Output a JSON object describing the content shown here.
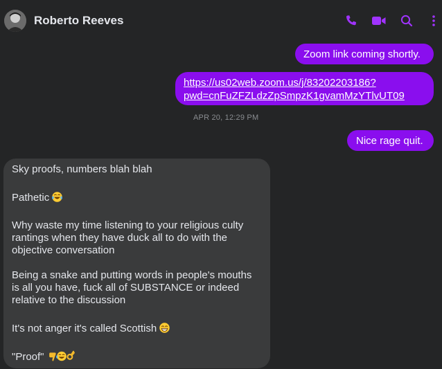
{
  "header": {
    "contact_name": "Roberto Reeves",
    "icons": [
      "phone-icon",
      "video-camera-icon",
      "search-icon",
      "more-options-icon"
    ],
    "accent_color": "#8a0eee"
  },
  "messages": {
    "outgoing_1": "Zoom link coming shortly.",
    "outgoing_2_line1": "https://us02web.zoom.us/j/83202203186?",
    "outgoing_2_line2": "pwd=cnFuZFZLdzZpSmpzK1gvamMzYTlvUT09",
    "timestamp": "APR 20, 12:29 PM",
    "outgoing_3": "Nice rage quit.",
    "incoming": {
      "p1": "Sky proofs, numbers blah blah",
      "p2": "Pathetic",
      "p3": "Why waste my time listening to your religious culty\nrantings when they have duck all to do with the\nobjective conversation",
      "p4": "Being a snake and putting words in people's mouths\nis all you have, fuck all of SUBSTANCE or indeed\nrelative to the discussion",
      "p5": "It's not anger it's called Scottish",
      "p6": "\"Proof\""
    }
  }
}
